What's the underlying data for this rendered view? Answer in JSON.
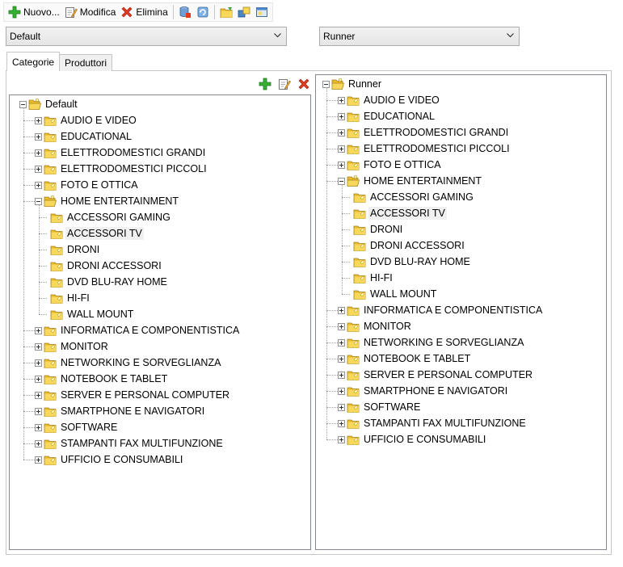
{
  "toolbar": {
    "new_label": "Nuovo...",
    "edit_label": "Modifica",
    "delete_label": "Elimina"
  },
  "combos": {
    "left_value": "Default",
    "right_value": "Runner"
  },
  "tabs": [
    {
      "label": "Categorie",
      "active": true
    },
    {
      "label": "Produttori",
      "active": false
    }
  ],
  "left_tree": {
    "root": "Default",
    "items": [
      "AUDIO E VIDEO",
      "EDUCATIONAL",
      "ELETTRODOMESTICI GRANDI",
      "ELETTRODOMESTICI PICCOLI",
      "FOTO E OTTICA",
      "HOME ENTERTAINMENT",
      "INFORMATICA E COMPONENTISTICA",
      "MONITOR",
      "NETWORKING E SORVEGLIANZA",
      "NOTEBOOK E TABLET",
      "SERVER E PERSONAL COMPUTER",
      "SMARTPHONE E NAVIGATORI",
      "SOFTWARE",
      "STAMPANTI FAX MULTIFUNZIONE",
      "UFFICIO E CONSUMABILI"
    ],
    "expanded_children": [
      "ACCESSORI GAMING",
      "ACCESSORI TV",
      "DRONI",
      "DRONI ACCESSORI",
      "DVD BLU-RAY HOME",
      "HI-FI",
      "WALL MOUNT"
    ],
    "selected": "ACCESSORI TV"
  },
  "right_tree": {
    "root": "Runner",
    "items": [
      "AUDIO E VIDEO",
      "EDUCATIONAL",
      "ELETTRODOMESTICI GRANDI",
      "ELETTRODOMESTICI PICCOLI",
      "FOTO E OTTICA",
      "HOME ENTERTAINMENT",
      "INFORMATICA E COMPONENTISTICA",
      "MONITOR",
      "NETWORKING E SORVEGLIANZA",
      "NOTEBOOK E TABLET",
      "SERVER E PERSONAL COMPUTER",
      "SMARTPHONE E NAVIGATORI",
      "SOFTWARE",
      "STAMPANTI FAX MULTIFUNZIONE",
      "UFFICIO E CONSUMABILI"
    ],
    "expanded_children": [
      "ACCESSORI GAMING",
      "ACCESSORI TV",
      "DRONI",
      "DRONI ACCESSORI",
      "DVD BLU-RAY HOME",
      "HI-FI",
      "WALL MOUNT"
    ],
    "selected": "ACCESSORI TV"
  },
  "colors": {
    "folder_yellow": "#f5d34a",
    "folder_shade": "#c9a21c",
    "add_green": "#2fa82f",
    "delete_red": "#e0301e"
  }
}
